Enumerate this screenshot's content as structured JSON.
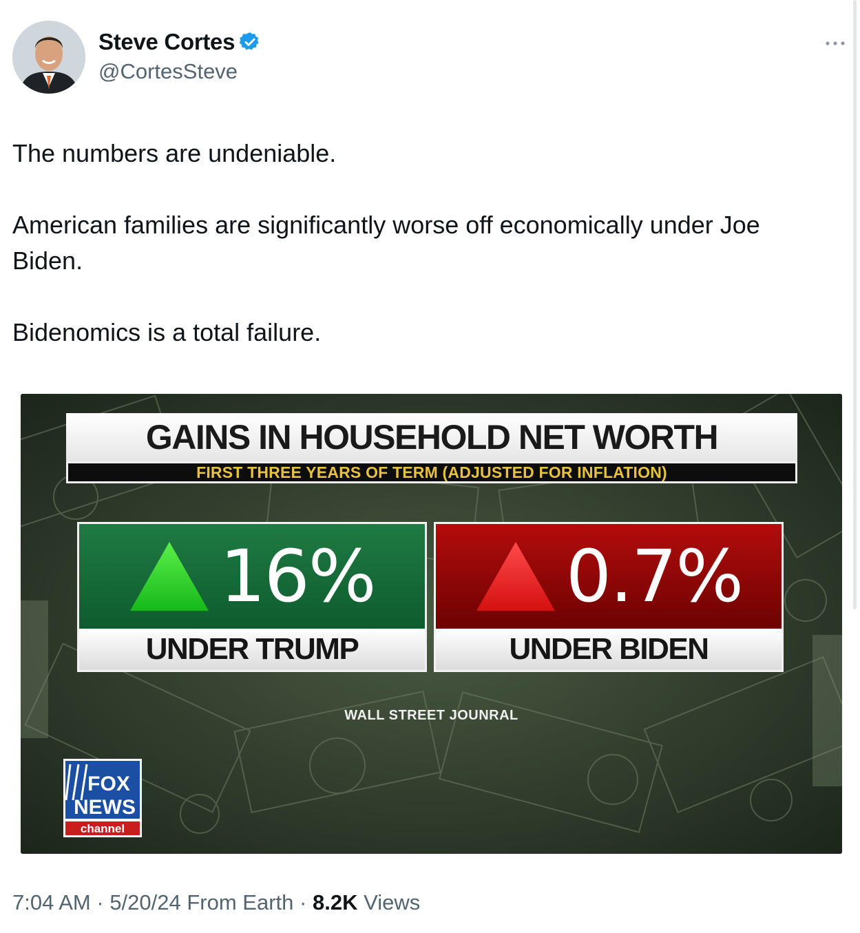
{
  "author": {
    "display_name": "Steve Cortes",
    "handle": "@CortesSteve",
    "verified": true,
    "avatar_icon": "profile-photo"
  },
  "tweet": {
    "paragraphs": [
      "The numbers are undeniable.",
      "American families are significantly worse off economically under Joe Biden.",
      "Bidenomics is a total failure."
    ]
  },
  "media": {
    "title": "GAINS IN HOUSEHOLD NET WORTH",
    "subtitle": "FIRST THREE YEARS OF TERM (ADJUSTED FOR INFLATION)",
    "panels": [
      {
        "value": "16%",
        "label": "UNDER TRUMP",
        "color": "#1b6e3b",
        "icon": "up-triangle-green"
      },
      {
        "value": "0.7%",
        "label": "UNDER BIDEN",
        "color": "#a00808",
        "icon": "up-triangle-red"
      }
    ],
    "source": "WALL STREET JOUNRAL",
    "logo": {
      "line1": "FOX",
      "line2": "NEWS",
      "line3": "channel"
    }
  },
  "meta": {
    "time": "7:04 AM",
    "date": "5/20/24",
    "source": "From Earth",
    "views_count": "8.2K",
    "views_label": "Views"
  },
  "colors": {
    "verified_blue": "#1d9bf0",
    "secondary_text": "#536471",
    "primary_text": "#0f1419"
  }
}
